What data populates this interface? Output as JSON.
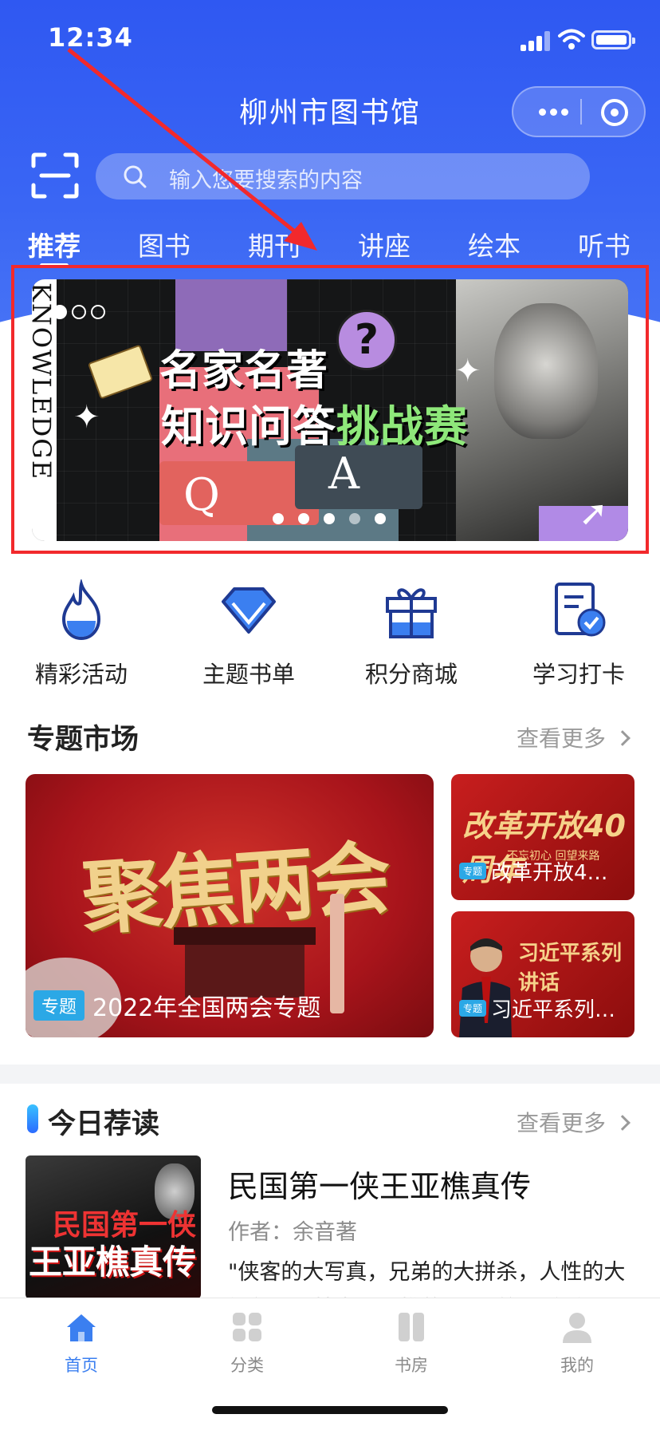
{
  "status_bar": {
    "time": "12:34"
  },
  "header": {
    "title": "柳州市图书馆"
  },
  "search": {
    "placeholder": "输入您要搜索的内容"
  },
  "tabs": [
    {
      "label": "推荐",
      "active": true
    },
    {
      "label": "图书"
    },
    {
      "label": "期刊"
    },
    {
      "label": "讲座"
    },
    {
      "label": "绘本"
    },
    {
      "label": "听书"
    }
  ],
  "banner": {
    "side_text": "KNOWLEDGE",
    "title_line1": "名家名著",
    "title_line2_a": "知识问答",
    "title_line2_b": "挑战赛",
    "q": "Q",
    "a": "A",
    "question_mark": "?",
    "slide_count": 5,
    "active_slide": 1
  },
  "quick_links": [
    {
      "label": "精彩活动",
      "icon": "flame-icon"
    },
    {
      "label": "主题书单",
      "icon": "diamond-icon"
    },
    {
      "label": "积分商城",
      "icon": "gift-icon"
    },
    {
      "label": "学习打卡",
      "icon": "checklist-icon"
    }
  ],
  "topics": {
    "title": "专题市场",
    "more": "查看更多",
    "big": {
      "art_text": "聚焦两会",
      "tag": "专题",
      "caption": "2022年全国两会专题"
    },
    "small": [
      {
        "art_text": "改革开放40周年",
        "art_sub": "不忘初心 回望来路",
        "tag": "专题",
        "caption": "改革开放4…"
      },
      {
        "art_text": "习近平系列讲话",
        "tag": "专题",
        "caption": "习近平系列…"
      }
    ]
  },
  "today": {
    "title": "今日荐读",
    "more": "查看更多",
    "book": {
      "cover_line1": "民国第一侠",
      "cover_line2": "王亚樵真传",
      "title": "民国第一侠王亚樵真传",
      "author": "作者：余音著",
      "description": "\"侠客的大写真，兄弟的大拼杀，人性的大解剖。无愧为王亚樵的“民国第一杀手”"
    }
  },
  "tabbar": [
    {
      "label": "首页",
      "active": true
    },
    {
      "label": "分类"
    },
    {
      "label": "书房"
    },
    {
      "label": "我的"
    }
  ],
  "colors": {
    "brand_blue": "#3a66f4",
    "active_tab": "#3b7ff0",
    "annotation_red": "#f2292c"
  }
}
